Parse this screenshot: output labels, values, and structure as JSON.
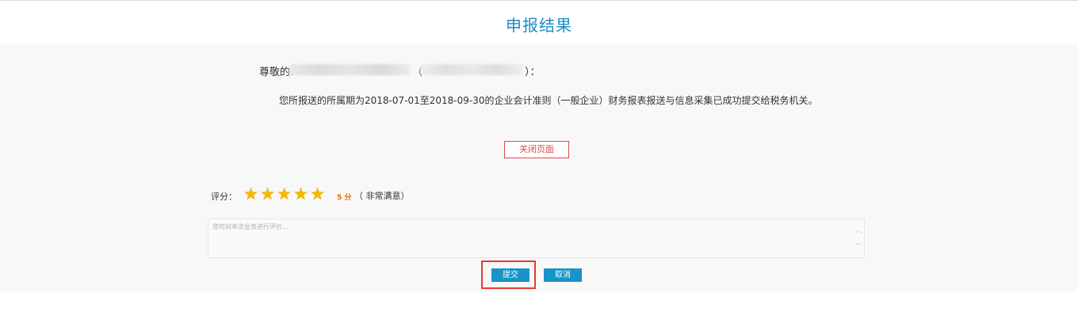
{
  "page": {
    "title": "申报结果"
  },
  "greeting": {
    "prefix": "尊敬的:",
    "paren_open": "（",
    "paren_close": "）："
  },
  "message": "您所报送的所属期为2018-07-01至2018-09-30的企业会计准则（一般企业）财务报表报送与信息采集已成功提交给税务机关。",
  "close_button": "关闭页面",
  "rating": {
    "label": "评分：",
    "stars_filled": 5,
    "stars_total": 5,
    "score_text": "5 分",
    "description": "（  非常满意）"
  },
  "comment": {
    "placeholder": "您可对本次业务进行评价..."
  },
  "buttons": {
    "submit": "提交",
    "cancel": "取消"
  },
  "colors": {
    "accent": "#1894c8",
    "title": "#1a8ec2",
    "danger": "#e53935",
    "star": "#f5b800"
  }
}
